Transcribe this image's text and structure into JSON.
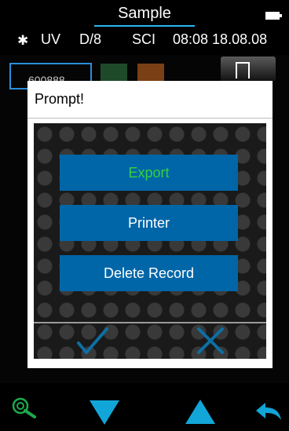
{
  "header": {
    "title": "Sample",
    "battery_icon": "battery-full-icon"
  },
  "status": {
    "bluetooth_icon": "bluetooth-icon",
    "uv": "UV",
    "geometry": "D/8",
    "mode": "SCI",
    "datetime": "08:08 18.08.08"
  },
  "background": {
    "sample_id": "600888"
  },
  "dialog": {
    "title": "Prompt!",
    "options": [
      {
        "label": "Export",
        "color": "#35d13e"
      },
      {
        "label": "Printer"
      },
      {
        "label": "Delete Record"
      }
    ],
    "confirm_icon": "check-icon",
    "cancel_icon": "x-icon"
  },
  "bottom_bar": {
    "icons": [
      "target-search-icon",
      "arrow-down-icon",
      "arrow-up-icon",
      "back-arrow-icon"
    ]
  },
  "colors": {
    "accent": "#2bb5f2",
    "button_blue": "#0066a8",
    "highlight_green": "#35d13e",
    "icon_teal": "#12a6d8"
  }
}
